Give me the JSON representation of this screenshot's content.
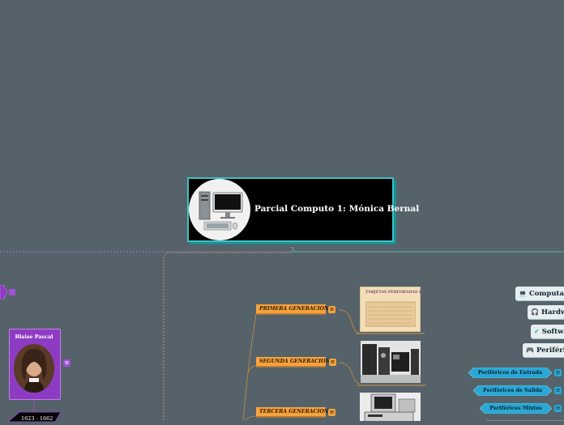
{
  "root": {
    "title": "Parcial Computo 1: Mónica Bernal",
    "icon": "desktop-computer-icon"
  },
  "generations": [
    {
      "label": "PRIMERA GENERACION"
    },
    {
      "label": "SEGUNDA GENERACION"
    },
    {
      "label": "TERCERA GENERACION"
    }
  ],
  "punch_card": {
    "label": "TARJETAS PERFORADAS ⚙"
  },
  "pascal": {
    "name": "Blaise Pascal",
    "years": "1623 - 1662"
  },
  "categories": [
    {
      "label": "Computadora",
      "icon": "computer-icon"
    },
    {
      "label": "Hardware",
      "icon": "headphones-icon"
    },
    {
      "label": "Software",
      "icon": "check-circle-icon"
    },
    {
      "label": "Periféricos",
      "icon": "gamepad-icon"
    }
  ],
  "perifericos": [
    {
      "label": "Periféricos de Entrada"
    },
    {
      "label": "Periféricos de Salida"
    },
    {
      "label": "Periféricos Mixtos"
    }
  ],
  "colors": {
    "background": "#56626a",
    "root_border": "#3ec1c4",
    "generation": "#f6a33d",
    "pascal": "#8e3bc4",
    "peripheral": "#2aa7d4"
  }
}
